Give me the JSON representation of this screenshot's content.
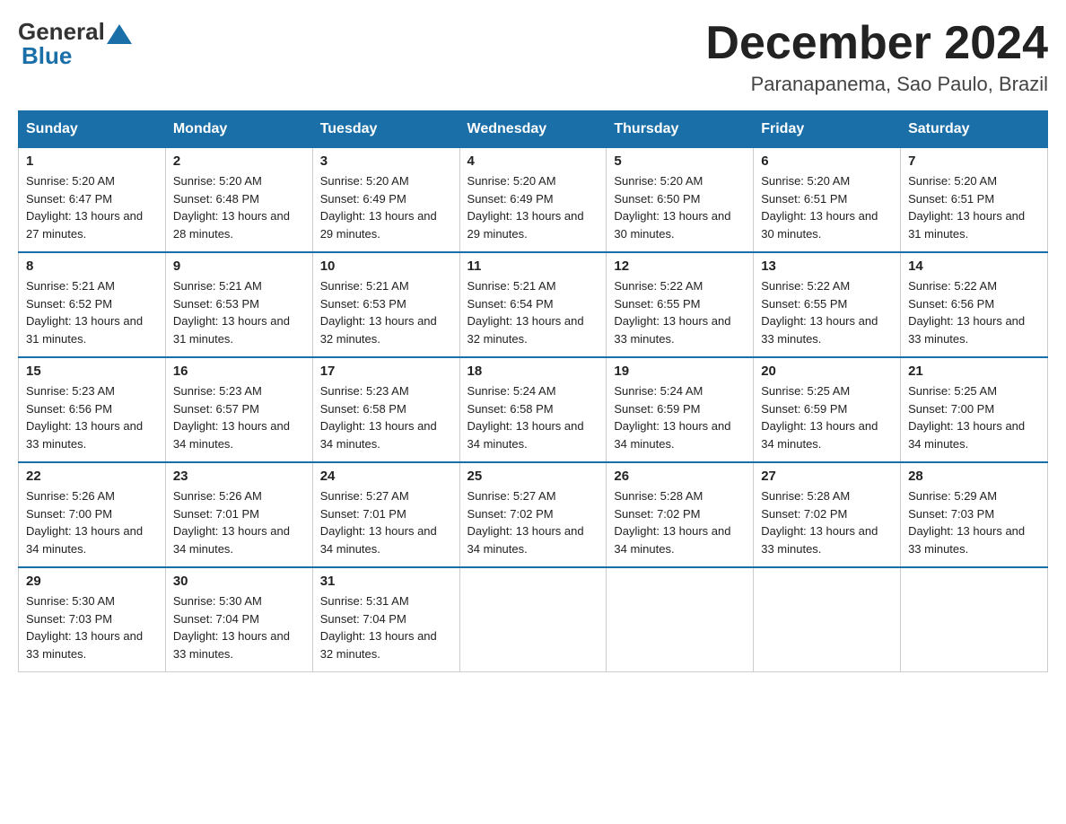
{
  "header": {
    "logo": {
      "general": "General",
      "triangle_color": "#1a6fa8",
      "blue": "Blue"
    },
    "title": "December 2024",
    "subtitle": "Paranapanema, Sao Paulo, Brazil"
  },
  "calendar": {
    "days_of_week": [
      "Sunday",
      "Monday",
      "Tuesday",
      "Wednesday",
      "Thursday",
      "Friday",
      "Saturday"
    ],
    "weeks": [
      [
        {
          "day": "1",
          "sunrise": "Sunrise: 5:20 AM",
          "sunset": "Sunset: 6:47 PM",
          "daylight": "Daylight: 13 hours and 27 minutes."
        },
        {
          "day": "2",
          "sunrise": "Sunrise: 5:20 AM",
          "sunset": "Sunset: 6:48 PM",
          "daylight": "Daylight: 13 hours and 28 minutes."
        },
        {
          "day": "3",
          "sunrise": "Sunrise: 5:20 AM",
          "sunset": "Sunset: 6:49 PM",
          "daylight": "Daylight: 13 hours and 29 minutes."
        },
        {
          "day": "4",
          "sunrise": "Sunrise: 5:20 AM",
          "sunset": "Sunset: 6:49 PM",
          "daylight": "Daylight: 13 hours and 29 minutes."
        },
        {
          "day": "5",
          "sunrise": "Sunrise: 5:20 AM",
          "sunset": "Sunset: 6:50 PM",
          "daylight": "Daylight: 13 hours and 30 minutes."
        },
        {
          "day": "6",
          "sunrise": "Sunrise: 5:20 AM",
          "sunset": "Sunset: 6:51 PM",
          "daylight": "Daylight: 13 hours and 30 minutes."
        },
        {
          "day": "7",
          "sunrise": "Sunrise: 5:20 AM",
          "sunset": "Sunset: 6:51 PM",
          "daylight": "Daylight: 13 hours and 31 minutes."
        }
      ],
      [
        {
          "day": "8",
          "sunrise": "Sunrise: 5:21 AM",
          "sunset": "Sunset: 6:52 PM",
          "daylight": "Daylight: 13 hours and 31 minutes."
        },
        {
          "day": "9",
          "sunrise": "Sunrise: 5:21 AM",
          "sunset": "Sunset: 6:53 PM",
          "daylight": "Daylight: 13 hours and 31 minutes."
        },
        {
          "day": "10",
          "sunrise": "Sunrise: 5:21 AM",
          "sunset": "Sunset: 6:53 PM",
          "daylight": "Daylight: 13 hours and 32 minutes."
        },
        {
          "day": "11",
          "sunrise": "Sunrise: 5:21 AM",
          "sunset": "Sunset: 6:54 PM",
          "daylight": "Daylight: 13 hours and 32 minutes."
        },
        {
          "day": "12",
          "sunrise": "Sunrise: 5:22 AM",
          "sunset": "Sunset: 6:55 PM",
          "daylight": "Daylight: 13 hours and 33 minutes."
        },
        {
          "day": "13",
          "sunrise": "Sunrise: 5:22 AM",
          "sunset": "Sunset: 6:55 PM",
          "daylight": "Daylight: 13 hours and 33 minutes."
        },
        {
          "day": "14",
          "sunrise": "Sunrise: 5:22 AM",
          "sunset": "Sunset: 6:56 PM",
          "daylight": "Daylight: 13 hours and 33 minutes."
        }
      ],
      [
        {
          "day": "15",
          "sunrise": "Sunrise: 5:23 AM",
          "sunset": "Sunset: 6:56 PM",
          "daylight": "Daylight: 13 hours and 33 minutes."
        },
        {
          "day": "16",
          "sunrise": "Sunrise: 5:23 AM",
          "sunset": "Sunset: 6:57 PM",
          "daylight": "Daylight: 13 hours and 34 minutes."
        },
        {
          "day": "17",
          "sunrise": "Sunrise: 5:23 AM",
          "sunset": "Sunset: 6:58 PM",
          "daylight": "Daylight: 13 hours and 34 minutes."
        },
        {
          "day": "18",
          "sunrise": "Sunrise: 5:24 AM",
          "sunset": "Sunset: 6:58 PM",
          "daylight": "Daylight: 13 hours and 34 minutes."
        },
        {
          "day": "19",
          "sunrise": "Sunrise: 5:24 AM",
          "sunset": "Sunset: 6:59 PM",
          "daylight": "Daylight: 13 hours and 34 minutes."
        },
        {
          "day": "20",
          "sunrise": "Sunrise: 5:25 AM",
          "sunset": "Sunset: 6:59 PM",
          "daylight": "Daylight: 13 hours and 34 minutes."
        },
        {
          "day": "21",
          "sunrise": "Sunrise: 5:25 AM",
          "sunset": "Sunset: 7:00 PM",
          "daylight": "Daylight: 13 hours and 34 minutes."
        }
      ],
      [
        {
          "day": "22",
          "sunrise": "Sunrise: 5:26 AM",
          "sunset": "Sunset: 7:00 PM",
          "daylight": "Daylight: 13 hours and 34 minutes."
        },
        {
          "day": "23",
          "sunrise": "Sunrise: 5:26 AM",
          "sunset": "Sunset: 7:01 PM",
          "daylight": "Daylight: 13 hours and 34 minutes."
        },
        {
          "day": "24",
          "sunrise": "Sunrise: 5:27 AM",
          "sunset": "Sunset: 7:01 PM",
          "daylight": "Daylight: 13 hours and 34 minutes."
        },
        {
          "day": "25",
          "sunrise": "Sunrise: 5:27 AM",
          "sunset": "Sunset: 7:02 PM",
          "daylight": "Daylight: 13 hours and 34 minutes."
        },
        {
          "day": "26",
          "sunrise": "Sunrise: 5:28 AM",
          "sunset": "Sunset: 7:02 PM",
          "daylight": "Daylight: 13 hours and 34 minutes."
        },
        {
          "day": "27",
          "sunrise": "Sunrise: 5:28 AM",
          "sunset": "Sunset: 7:02 PM",
          "daylight": "Daylight: 13 hours and 33 minutes."
        },
        {
          "day": "28",
          "sunrise": "Sunrise: 5:29 AM",
          "sunset": "Sunset: 7:03 PM",
          "daylight": "Daylight: 13 hours and 33 minutes."
        }
      ],
      [
        {
          "day": "29",
          "sunrise": "Sunrise: 5:30 AM",
          "sunset": "Sunset: 7:03 PM",
          "daylight": "Daylight: 13 hours and 33 minutes."
        },
        {
          "day": "30",
          "sunrise": "Sunrise: 5:30 AM",
          "sunset": "Sunset: 7:04 PM",
          "daylight": "Daylight: 13 hours and 33 minutes."
        },
        {
          "day": "31",
          "sunrise": "Sunrise: 5:31 AM",
          "sunset": "Sunset: 7:04 PM",
          "daylight": "Daylight: 13 hours and 32 minutes."
        },
        null,
        null,
        null,
        null
      ]
    ]
  }
}
